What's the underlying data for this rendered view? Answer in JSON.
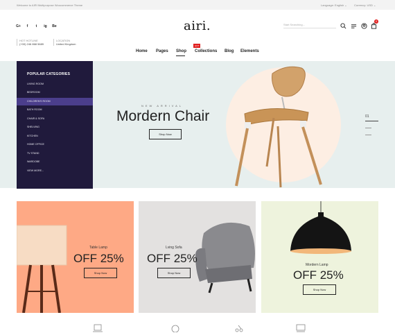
{
  "topbar": {
    "welcome": "Welcome to AIRI Multipurpose Woocommerce Theme",
    "language": "Language: English",
    "currency": "Currency: USD"
  },
  "social": [
    "G+",
    "f",
    "t",
    "ig",
    "Be"
  ],
  "logo": "airi.",
  "header": {
    "search_placeholder": "Start Searching...",
    "cart_count": "0",
    "hotline_label": "HOT HOTLINE",
    "hotline_value": "(+00) 246 868 5689",
    "location_label": "LOCATION",
    "location_value": "United Kingdom"
  },
  "nav": {
    "items": [
      "Home",
      "Pages",
      "Shop",
      "Collections",
      "Blog",
      "Elements"
    ],
    "hot_badge": "HOT"
  },
  "sidebar": {
    "title": "POPULAR CATEGORIES",
    "items": [
      "LIVING ROOM",
      "BEDROOM",
      "CHILDREN'S ROOM",
      "BATH ROOM",
      "CHAIR & SOFA",
      "SHELVING",
      "KITCHEN",
      "HOME OFFICE",
      "TV STAND",
      "WARDOBE",
      "VIEW MORE..."
    ]
  },
  "hero": {
    "eyebrow": "NEW ARRIVAL",
    "title": "Mordern Chair",
    "button": "Shop Now",
    "slide_number": "01"
  },
  "banners": [
    {
      "label": "Table Lamp",
      "offer": "OFF 25%",
      "button": "Shop Now",
      "bg": "#fea985"
    },
    {
      "label": "Lving Sofa",
      "offer": "OFF 25%",
      "button": "Shop Now",
      "bg": "#e3e1e0"
    },
    {
      "label": "Mordern Lamp",
      "offer": "OFF 25%",
      "button": "Shop Now",
      "bg": "#eef3dd"
    }
  ],
  "colors": {
    "accent": "#e02020",
    "sidebar": "#201a3c",
    "sidebar_active": "#4b3e8c"
  }
}
